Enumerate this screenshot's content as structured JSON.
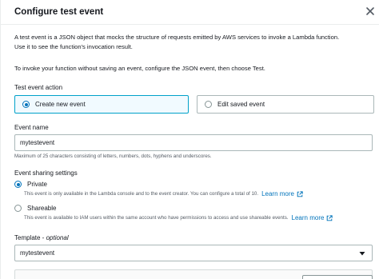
{
  "modal": {
    "title": "Configure test event"
  },
  "intro": {
    "line1": "A test event is a JSON object that mocks the structure of requests emitted by AWS services to invoke a Lambda function.",
    "line2": "Use it to see the function's invocation result.",
    "line3": "To invoke your function without saving an event, configure the JSON event, then choose Test."
  },
  "test_event_action": {
    "label": "Test event action",
    "options": [
      {
        "label": "Create new event",
        "selected": true
      },
      {
        "label": "Edit saved event",
        "selected": false
      }
    ]
  },
  "event_name": {
    "label": "Event name",
    "value": "mytestevent",
    "hint": "Maximum of 25 characters consisting of letters, numbers, dots, hyphens and underscores."
  },
  "sharing": {
    "label": "Event sharing settings",
    "options": [
      {
        "label": "Private",
        "selected": true,
        "description": "This event is only available in the Lambda console and to the event creator. You can configure a total of 10.",
        "link": "Learn more"
      },
      {
        "label": "Shareable",
        "selected": false,
        "description": "This event is available to IAM users within the same account who have permissions to access and use shareable events.",
        "link": "Learn more"
      }
    ]
  },
  "template": {
    "label": "Template - ",
    "label_optional": "optional",
    "value": "mytestevent"
  },
  "colors": {
    "accent": "#0073bb",
    "selected_tile_bg": "#f1faff",
    "selected_tile_border": "#00a1c9"
  },
  "icons": [
    "close-icon",
    "external-link-icon",
    "chevron-down-icon"
  ]
}
